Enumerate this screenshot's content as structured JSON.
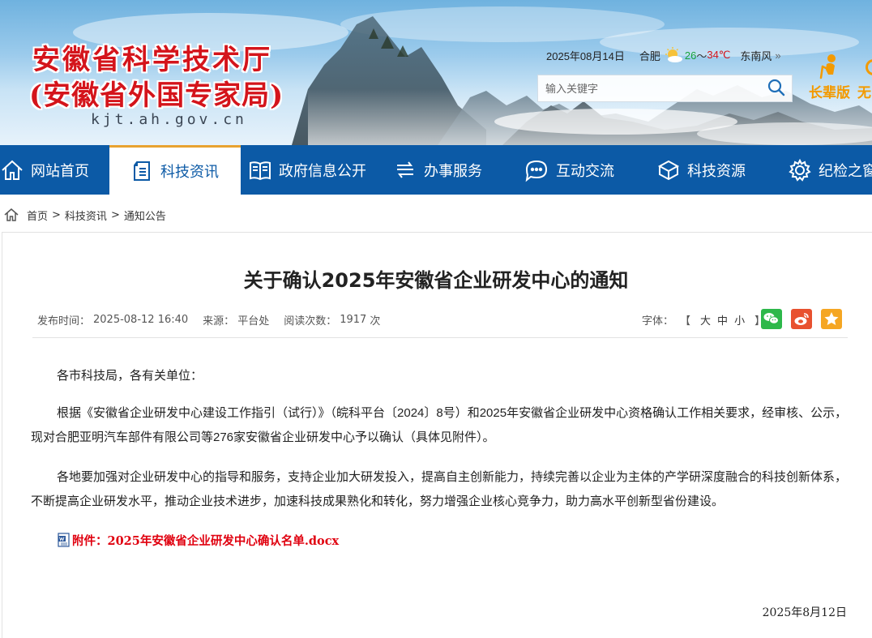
{
  "header": {
    "title": "安徽省科学技术厅",
    "subtitle": "(安徽省外国专家局)",
    "domain": "kjt.ah.gov.cn",
    "weather": {
      "date": "2025年08月14日",
      "city": "合肥",
      "low": "26",
      "tilde": "～",
      "high": "34℃",
      "wind": "东南风",
      "more": "»",
      "icon": "sunny-cloud-icon"
    },
    "search_placeholder": "输入关键字",
    "elder_label": "长辈版",
    "noaccess_label": "无"
  },
  "nav": {
    "items": [
      {
        "label": "网站首页",
        "icon": "home-icon"
      },
      {
        "label": "科技资讯",
        "icon": "document-icon",
        "active": true
      },
      {
        "label": "政府信息公开",
        "icon": "book-icon"
      },
      {
        "label": "办事服务",
        "icon": "service-icon"
      },
      {
        "label": "互动交流",
        "icon": "chat-icon"
      },
      {
        "label": "科技资源",
        "icon": "cube-icon"
      },
      {
        "label": "纪检之窗",
        "icon": "gear-icon"
      }
    ],
    "active_color": "#0c5aa6",
    "accent_color": "#e8a230"
  },
  "breadcrumb": {
    "items": [
      "首页",
      "科技资讯",
      "通知公告"
    ],
    "separator": ">"
  },
  "article": {
    "title": "关于确认2025年安徽省企业研发中心的通知",
    "meta": {
      "publish_label": "发布时间：",
      "publish_time": "2025-08-12 16:40",
      "source_label": "来源：",
      "source": "平台处",
      "views_label": "阅读次数：",
      "views": "1917",
      "views_unit": "次"
    },
    "font_size": {
      "label": "字体：",
      "open": "【",
      "large": "大",
      "medium": "中",
      "small": "小",
      "close": "】"
    },
    "share": [
      "wechat-icon",
      "weibo-icon",
      "favorite-icon"
    ],
    "salutation": "各市科技局，各有关单位：",
    "paragraph_1": "根据《安徽省企业研发中心建设工作指引（试行）》（皖科平台〔2024〕8号）和2025年安徽省企业研发中心资格确认工作相关要求，经审核、公示，现对合肥亚明汽车部件有限公司等276家安徽省企业研发中心予以确认（具体见附件）。",
    "paragraph_2": "各地要加强对企业研发中心的指导和服务，支持企业加大研发投入，提高自主创新能力，持续完善以企业为主体的产学研深度融合的科技创新体系，不断提高企业研发水平，推动企业技术进步，加速科技成果熟化和转化，努力增强企业核心竞争力，助力高水平创新型省份建设。",
    "attachment": "附件：2025年安徽省企业研发中心确认名单.docx",
    "sign_date": "2025年8月12日"
  }
}
